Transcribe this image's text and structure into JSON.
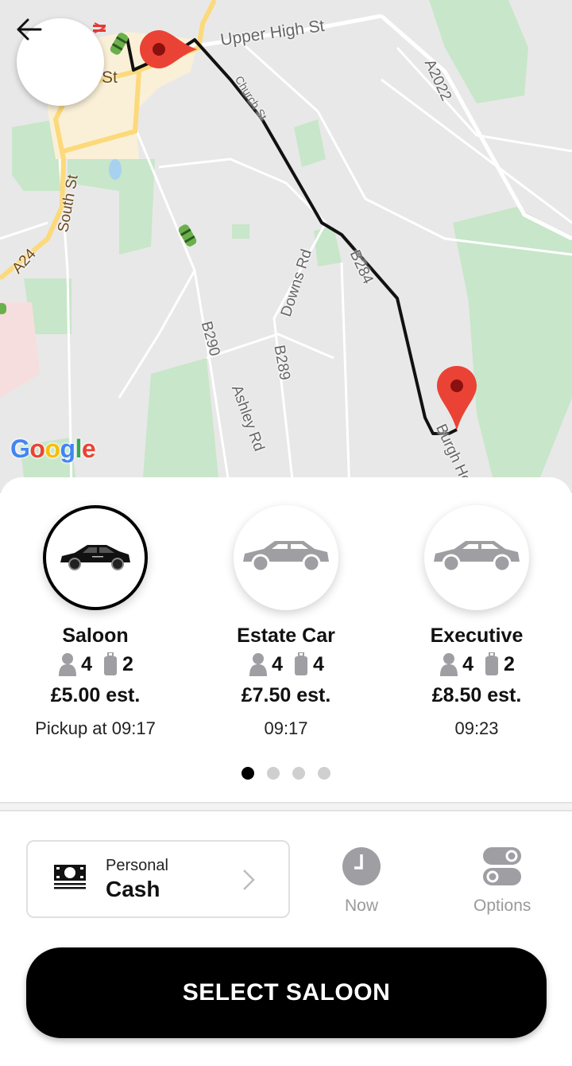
{
  "map": {
    "labels": {
      "upper_high_st": "Upper High St",
      "church_st": "Church St",
      "a2022": "A2022",
      "st_fragment": "St",
      "south_st": "South St",
      "a24": "A24",
      "downs_rd": "Downs Rd",
      "b284": "B284",
      "b290": "B290",
      "b289": "B289",
      "ashley_rd": "Ashley Rd",
      "burgh_heath": "Burgh He"
    },
    "attribution": {
      "letters": [
        "G",
        "o",
        "o",
        "g",
        "l",
        "e"
      ],
      "colors": [
        "#4285F4",
        "#EA4335",
        "#FBBC05",
        "#4285F4",
        "#34A853",
        "#EA4335"
      ]
    },
    "colors": {
      "pin": "#EA4335",
      "pin_center": "#8B1010",
      "route": "#111111",
      "park": "#c8e6c9",
      "major_road": "#fcd97a"
    }
  },
  "header": {
    "back_icon": "arrow-left-icon"
  },
  "vehicles": [
    {
      "name": "Saloon",
      "passengers": "4",
      "luggage": "2",
      "price": "£5.00 est.",
      "time": "Pickup at 09:17",
      "selected": true
    },
    {
      "name": "Estate Car",
      "passengers": "4",
      "luggage": "4",
      "price": "£7.50 est.",
      "time": "09:17",
      "selected": false
    },
    {
      "name": "Executive",
      "passengers": "4",
      "luggage": "2",
      "price": "£8.50 est.",
      "time": "09:23",
      "selected": false
    }
  ],
  "pagination": {
    "total": 4,
    "current": 1
  },
  "payment": {
    "account": "Personal",
    "method": "Cash",
    "icon": "cash-icon"
  },
  "tools": {
    "time_label": "Now",
    "options_label": "Options"
  },
  "select_button": "SELECT SALOON",
  "colors": {
    "accent": "#000000",
    "muted": "#9a9a9a",
    "icon_gray": "#9e9ea3"
  }
}
